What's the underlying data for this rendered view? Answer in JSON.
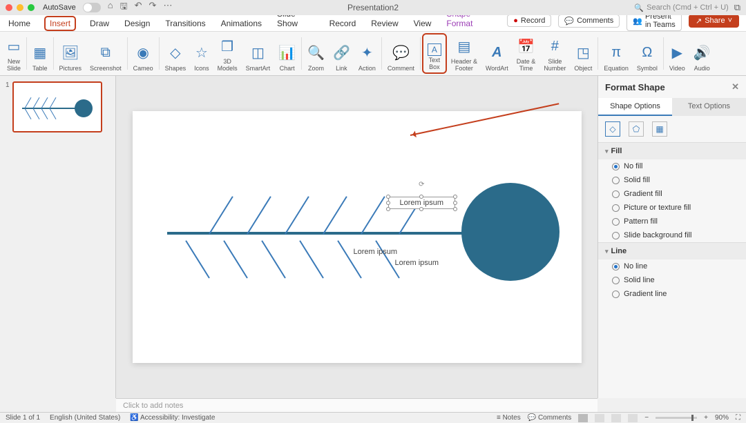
{
  "titlebar": {
    "autosave": "AutoSave",
    "title": "Presentation2",
    "search_placeholder": "Search (Cmd + Ctrl + U)"
  },
  "tabs": {
    "items": [
      "Home",
      "Insert",
      "Draw",
      "Design",
      "Transitions",
      "Animations",
      "Slide Show",
      "Record",
      "Review",
      "View",
      "Shape Format"
    ],
    "record": "Record",
    "comments": "Comments",
    "present": "Present in Teams",
    "share": "Share"
  },
  "ribbon": {
    "items": [
      {
        "label": "New\nSlide",
        "icon": "new-slide"
      },
      {
        "label": "Table",
        "icon": "table"
      },
      {
        "label": "Pictures",
        "icon": "pictures"
      },
      {
        "label": "Screenshot",
        "icon": "screenshot"
      },
      {
        "label": "Cameo",
        "icon": "cameo"
      },
      {
        "label": "Shapes",
        "icon": "shapes"
      },
      {
        "label": "Icons",
        "icon": "icons"
      },
      {
        "label": "3D\nModels",
        "icon": "3d"
      },
      {
        "label": "SmartArt",
        "icon": "smartart"
      },
      {
        "label": "Chart",
        "icon": "chart"
      },
      {
        "label": "Zoom",
        "icon": "zoom"
      },
      {
        "label": "Link",
        "icon": "link"
      },
      {
        "label": "Action",
        "icon": "action"
      },
      {
        "label": "Comment",
        "icon": "comment"
      },
      {
        "label": "Text\nBox",
        "icon": "textbox"
      },
      {
        "label": "Header &\nFooter",
        "icon": "header"
      },
      {
        "label": "WordArt",
        "icon": "wordart"
      },
      {
        "label": "Date &\nTime",
        "icon": "date"
      },
      {
        "label": "Slide\nNumber",
        "icon": "slidenum"
      },
      {
        "label": "Object",
        "icon": "object"
      },
      {
        "label": "Equation",
        "icon": "equation"
      },
      {
        "label": "Symbol",
        "icon": "symbol"
      },
      {
        "label": "Video",
        "icon": "video"
      },
      {
        "label": "Audio",
        "icon": "audio"
      }
    ]
  },
  "slide": {
    "text1": "Lorem ipsum",
    "text2": "Lorem ipsum",
    "text3": "Lorem ipsum"
  },
  "thumb": {
    "num": "1"
  },
  "fpane": {
    "title": "Format Shape",
    "tab1": "Shape Options",
    "tab2": "Text Options",
    "fill_title": "Fill",
    "fill_opts": [
      "No fill",
      "Solid fill",
      "Gradient fill",
      "Picture or texture fill",
      "Pattern fill",
      "Slide background fill"
    ],
    "line_title": "Line",
    "line_opts": [
      "No line",
      "Solid line",
      "Gradient line"
    ]
  },
  "notes": {
    "placeholder": "Click to add notes"
  },
  "status": {
    "slide": "Slide 1 of 1",
    "lang": "English (United States)",
    "access": "Accessibility: Investigate",
    "notes": "Notes",
    "comments": "Comments",
    "zoom": "90%"
  }
}
